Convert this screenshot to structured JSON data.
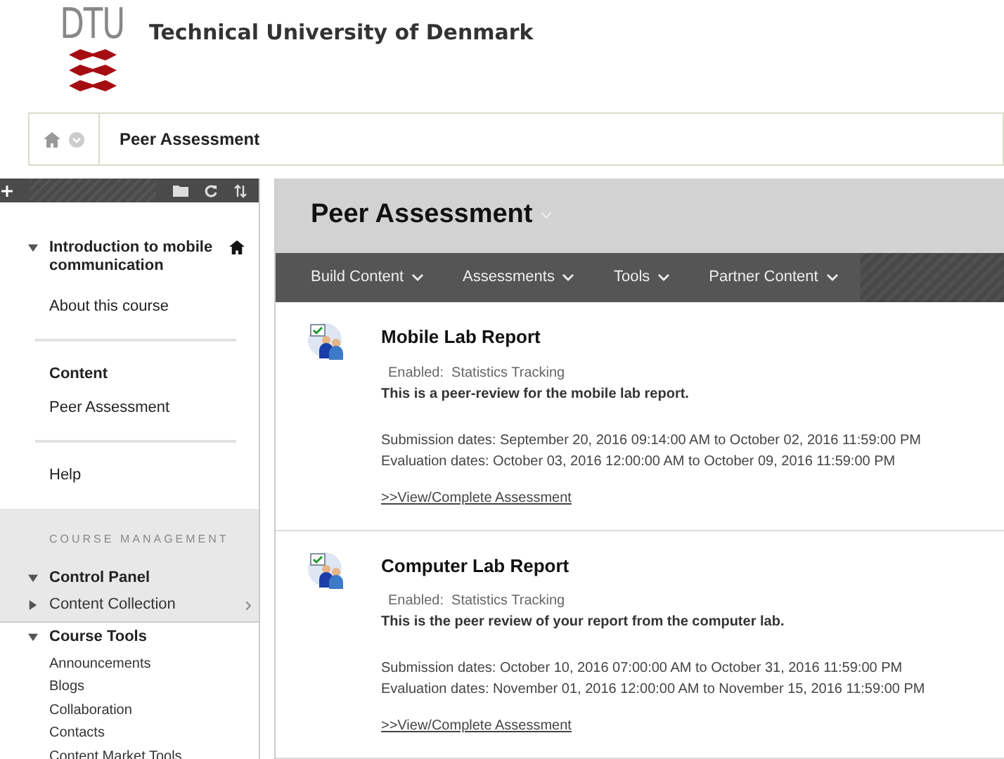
{
  "header": {
    "logo_text": "DTU",
    "title": "Technical University of Denmark"
  },
  "breadcrumb": {
    "current": "Peer Assessment"
  },
  "sidebar": {
    "course": {
      "title": "Introduction to mobile communication",
      "expanded": true
    },
    "menu": [
      {
        "kind": "link",
        "label": "About this course"
      },
      {
        "kind": "divider"
      },
      {
        "kind": "heading",
        "label": "Content"
      },
      {
        "kind": "link",
        "label": "Peer Assessment"
      },
      {
        "kind": "divider"
      },
      {
        "kind": "link",
        "label": "Help"
      }
    ],
    "management": {
      "heading": "COURSE MANAGEMENT",
      "panel": {
        "label": "Control Panel",
        "expanded": true
      },
      "sections": [
        {
          "label": "Content Collection",
          "expanded": false,
          "shaded": true
        },
        {
          "label": "Course Tools",
          "expanded": true,
          "shaded": false,
          "children": [
            "Announcements",
            "Blogs",
            "Collaboration",
            "Contacts",
            "Content Market Tools"
          ]
        }
      ]
    }
  },
  "page": {
    "title": "Peer Assessment",
    "menu": [
      "Build Content",
      "Assessments",
      "Tools",
      "Partner Content"
    ],
    "items": [
      {
        "title": "Mobile Lab Report",
        "status": "Enabled:  Statistics Tracking",
        "description": "This is a peer-review for the mobile lab report.",
        "submission": "Submission dates: September 20, 2016 09:14:00 AM to October 02, 2016 11:59:00 PM",
        "evaluation": "Evaluation dates: October 03, 2016 12:00:00 AM to October 09, 2016 11:59:00 PM",
        "link": ">>View/Complete Assessment"
      },
      {
        "title": "Computer Lab Report",
        "status": "Enabled:  Statistics Tracking",
        "description": "This is the peer review of your report from the computer lab.",
        "submission": "Submission dates: October 10, 2016 07:00:00 AM to October 31, 2016 11:59:00 PM",
        "evaluation": "Evaluation dates: November 01, 2016 12:00:00 AM to November 15, 2016 11:59:00 PM",
        "link": ">>View/Complete Assessment"
      }
    ]
  }
}
